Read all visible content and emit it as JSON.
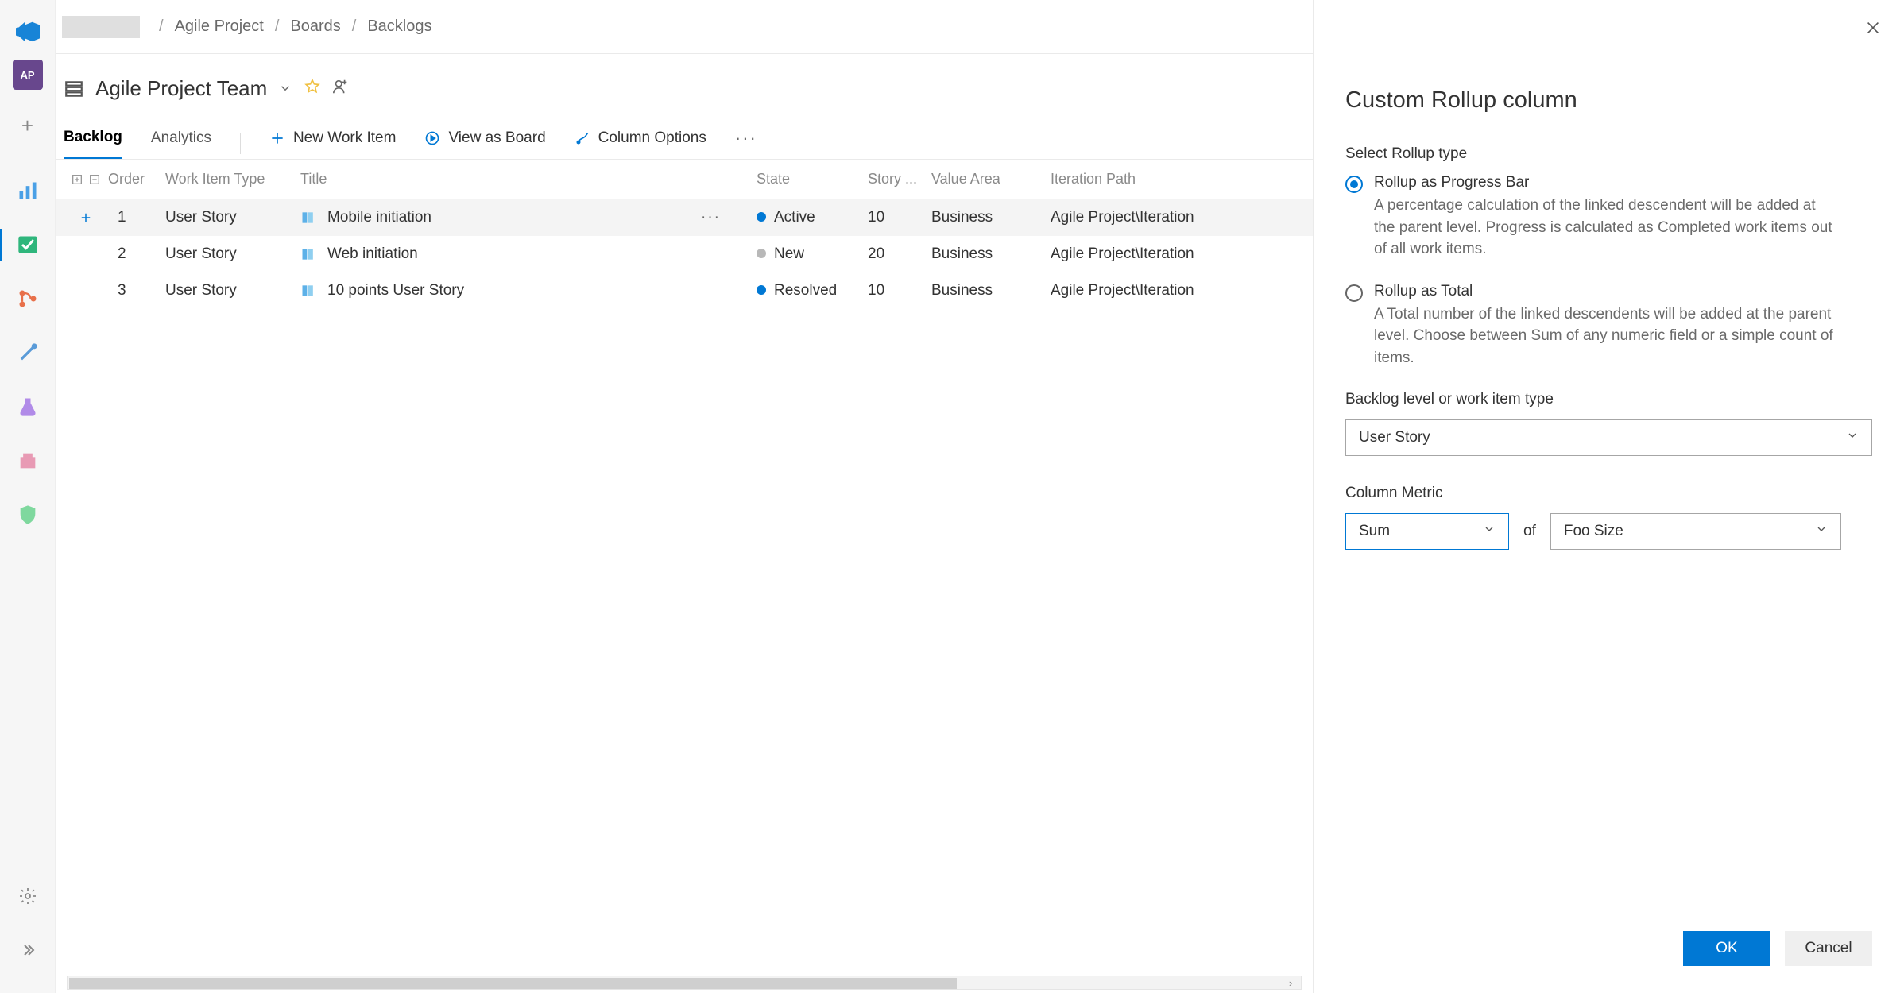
{
  "breadcrumbs": {
    "project": "Agile Project",
    "boards": "Boards",
    "backlogs": "Backlogs"
  },
  "header": {
    "team": "Agile Project Team",
    "project_badge": "AP"
  },
  "tabs": {
    "backlog": "Backlog",
    "analytics": "Analytics"
  },
  "toolbar": {
    "new_work_item": "New Work Item",
    "view_as_board": "View as Board",
    "column_options": "Column Options"
  },
  "columns": {
    "order": "Order",
    "type": "Work Item Type",
    "title": "Title",
    "state": "State",
    "points": "Story ...",
    "area": "Value Area",
    "iteration": "Iteration Path"
  },
  "rows": [
    {
      "order": "1",
      "type": "User Story",
      "title": "Mobile initiation",
      "state": "Active",
      "state_class": "dot-active",
      "points": "10",
      "area": "Business",
      "iteration": "Agile Project\\Iteration",
      "hover": true
    },
    {
      "order": "2",
      "type": "User Story",
      "title": "Web initiation",
      "state": "New",
      "state_class": "dot-new",
      "points": "20",
      "area": "Business",
      "iteration": "Agile Project\\Iteration",
      "hover": false
    },
    {
      "order": "3",
      "type": "User Story",
      "title": "10 points User Story",
      "state": "Resolved",
      "state_class": "dot-resolved",
      "points": "10",
      "area": "Business",
      "iteration": "Agile Project\\Iteration",
      "hover": false
    }
  ],
  "panel": {
    "title": "Custom Rollup column",
    "select_rollup": "Select Rollup type",
    "progress_label": "Rollup as Progress Bar",
    "progress_desc": "A percentage calculation of the linked descendent will be added at the parent level. Progress is calculated as Completed work items out of all work items.",
    "total_label": "Rollup as Total",
    "total_desc": "A Total number of the linked descendents will be added at the parent level. Choose between Sum of any numeric field or a simple count of items.",
    "backlog_label": "Backlog level or work item type",
    "backlog_value": "User Story",
    "metric_label": "Column Metric",
    "metric_value": "Sum",
    "of": "of",
    "field_value": "Foo Size",
    "ok": "OK",
    "cancel": "Cancel"
  }
}
